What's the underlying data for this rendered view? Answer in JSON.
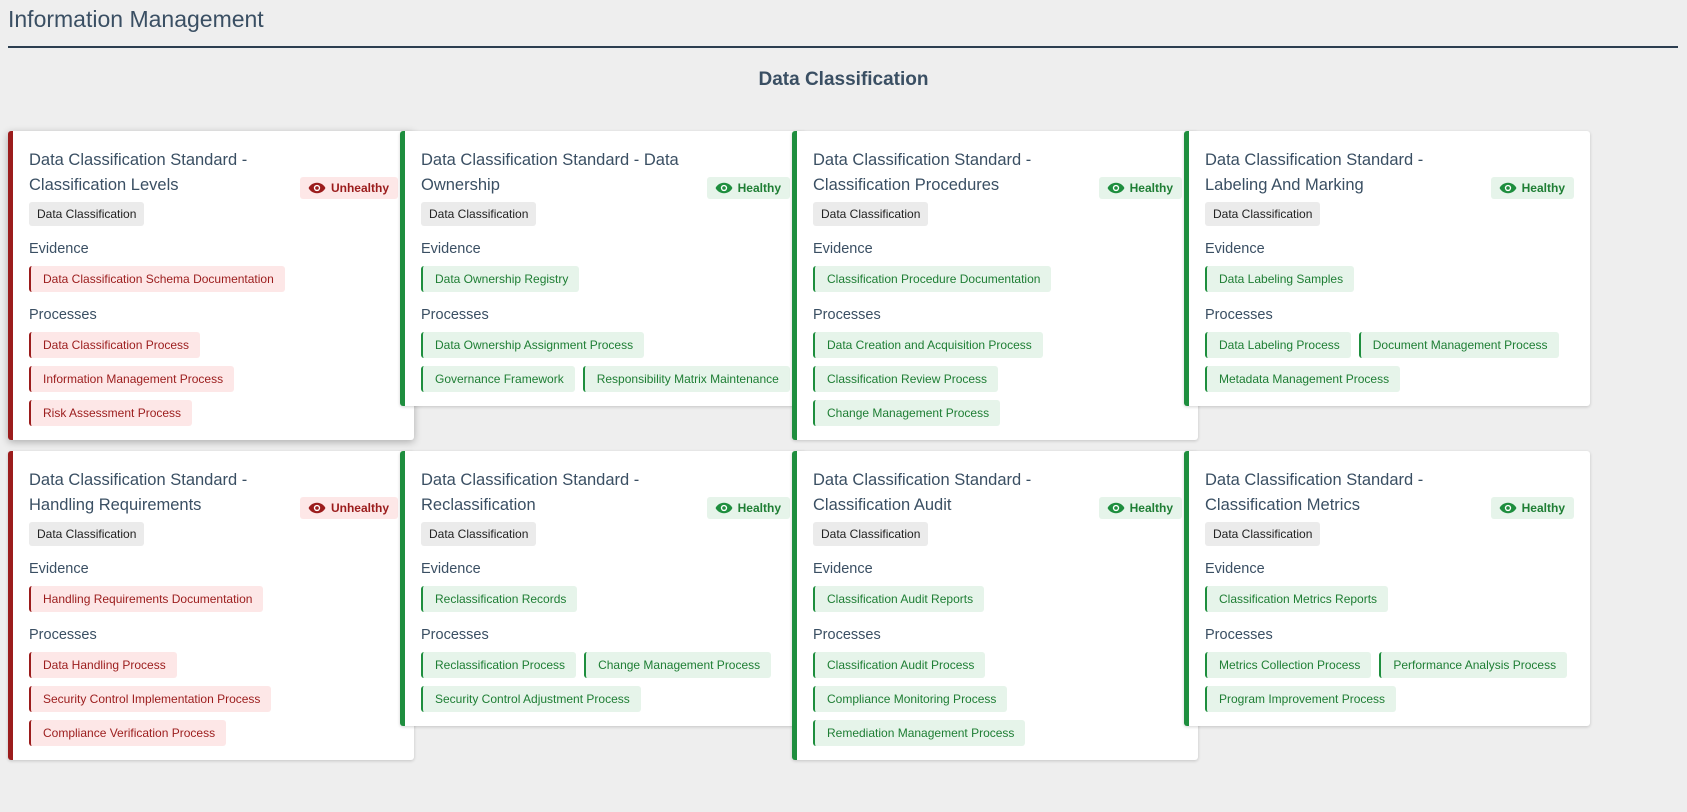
{
  "page": {
    "title": "Information Management",
    "section": "Data Classification"
  },
  "status_labels": {
    "healthy": "Healthy",
    "unhealthy": "Unhealthy"
  },
  "evidence_label": "Evidence",
  "processes_label": "Processes",
  "colors": {
    "healthy": "#1e8e3e",
    "unhealthy": "#9b1c1c"
  },
  "cards": [
    {
      "title": "Data Classification Standard - Classification Levels",
      "status": "unhealthy",
      "category": "Data Classification",
      "evidence": [
        "Data Classification Schema Documentation"
      ],
      "processes": [
        "Data Classification Process",
        "Information Management Process",
        "Risk Assessment Process"
      ]
    },
    {
      "title": "Data Classification Standard - Data Ownership",
      "status": "healthy",
      "category": "Data Classification",
      "evidence": [
        "Data Ownership Registry"
      ],
      "processes": [
        "Data Ownership Assignment Process",
        "Governance Framework",
        "Responsibility Matrix Maintenance"
      ]
    },
    {
      "title": "Data Classification Standard - Classification Procedures",
      "status": "healthy",
      "category": "Data Classification",
      "evidence": [
        "Classification Procedure Documentation"
      ],
      "processes": [
        "Data Creation and Acquisition Process",
        "Classification Review Process",
        "Change Management Process"
      ]
    },
    {
      "title": "Data Classification Standard - Labeling And Marking",
      "status": "healthy",
      "category": "Data Classification",
      "evidence": [
        "Data Labeling Samples"
      ],
      "processes": [
        "Data Labeling Process",
        "Document Management Process",
        "Metadata Management Process"
      ]
    },
    {
      "title": "Data Classification Standard - Handling Requirements",
      "status": "unhealthy",
      "category": "Data Classification",
      "evidence": [
        "Handling Requirements Documentation"
      ],
      "processes": [
        "Data Handling Process",
        "Security Control Implementation Process",
        "Compliance Verification Process"
      ]
    },
    {
      "title": "Data Classification Standard - Reclassification",
      "status": "healthy",
      "category": "Data Classification",
      "evidence": [
        "Reclassification Records"
      ],
      "processes": [
        "Reclassification Process",
        "Change Management Process",
        "Security Control Adjustment Process"
      ]
    },
    {
      "title": "Data Classification Standard - Classification Audit",
      "status": "healthy",
      "category": "Data Classification",
      "evidence": [
        "Classification Audit Reports"
      ],
      "processes": [
        "Classification Audit Process",
        "Compliance Monitoring Process",
        "Remediation Management Process"
      ]
    },
    {
      "title": "Data Classification Standard - Classification Metrics",
      "status": "healthy",
      "category": "Data Classification",
      "evidence": [
        "Classification Metrics Reports"
      ],
      "processes": [
        "Metrics Collection Process",
        "Performance Analysis Process",
        "Program Improvement Process"
      ]
    }
  ]
}
